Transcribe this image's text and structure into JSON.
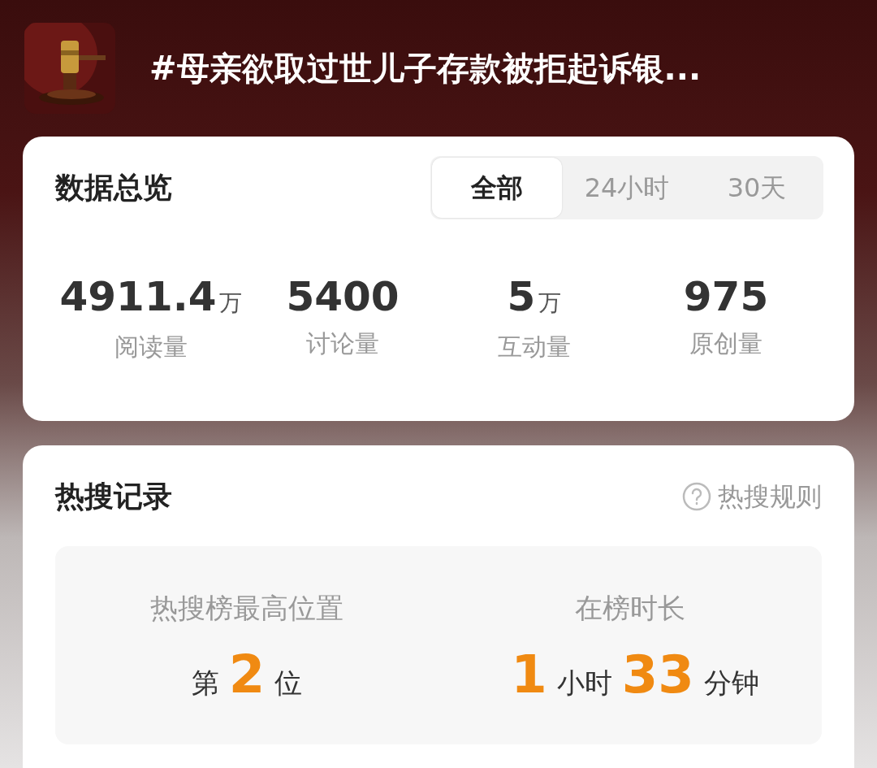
{
  "topic": {
    "title": "#母亲欲取过世儿子存款被拒起诉银..."
  },
  "overview": {
    "title": "数据总览",
    "tabs": [
      {
        "label": "全部",
        "selected": true
      },
      {
        "label": "24小时",
        "selected": false
      },
      {
        "label": "30天",
        "selected": false
      }
    ],
    "stats": [
      {
        "value": "4911.4",
        "unit": "万",
        "label": "阅读量"
      },
      {
        "value": "5400",
        "label": "讨论量"
      },
      {
        "value": "5",
        "unit": "万",
        "label": "互动量"
      },
      {
        "value": "975",
        "label": "原创量"
      }
    ]
  },
  "hot_search": {
    "title": "热搜记录",
    "rules_link": "热搜规则",
    "records": [
      {
        "label": "热搜榜最高位置",
        "parts": [
          {
            "kind": "text",
            "text": "第"
          },
          {
            "kind": "number",
            "text": "2"
          },
          {
            "kind": "text",
            "text": "位"
          }
        ]
      },
      {
        "label": "在榜时长",
        "parts": [
          {
            "kind": "number",
            "text": "1"
          },
          {
            "kind": "text",
            "text": "小时"
          },
          {
            "kind": "number",
            "text": "33"
          },
          {
            "kind": "text",
            "text": "分钟"
          }
        ]
      }
    ]
  }
}
